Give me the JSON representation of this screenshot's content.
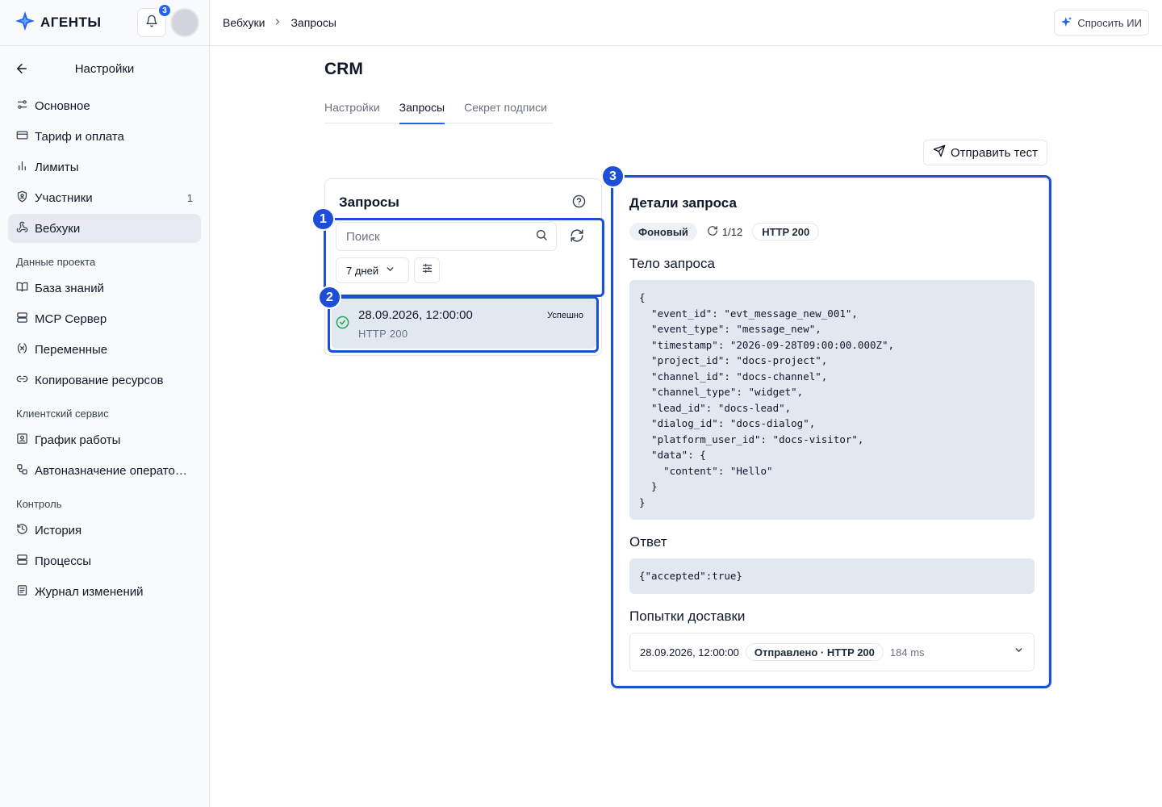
{
  "app": {
    "name": "АГЕНТЫ",
    "notifications_count": "3"
  },
  "sidebar": {
    "title": "Настройки",
    "items": [
      {
        "label": "Основное",
        "icon": "sliders-icon"
      },
      {
        "label": "Тариф и оплата",
        "icon": "credit-card-icon"
      },
      {
        "label": "Лимиты",
        "icon": "bar-chart-icon"
      },
      {
        "label": "Участники",
        "icon": "user-shield-icon",
        "count": "1"
      },
      {
        "label": "Вебхуки",
        "icon": "webhook-icon",
        "active": true
      }
    ],
    "section_project": "Данные проекта",
    "project_items": [
      {
        "label": "База знаний",
        "icon": "book-icon"
      },
      {
        "label": "MCP Сервер",
        "icon": "server-icon"
      },
      {
        "label": "Переменные",
        "icon": "variable-icon"
      },
      {
        "label": "Копирование ресурсов",
        "icon": "link-icon"
      }
    ],
    "section_client": "Клиентский сервис",
    "client_items": [
      {
        "label": "График работы",
        "icon": "calendar-icon"
      },
      {
        "label": "Автоназначение операторов",
        "icon": "workflow-icon"
      }
    ],
    "section_control": "Контроль",
    "control_items": [
      {
        "label": "История",
        "icon": "history-icon"
      },
      {
        "label": "Процессы",
        "icon": "server-icon"
      },
      {
        "label": "Журнал изменений",
        "icon": "log-icon"
      }
    ]
  },
  "topbar": {
    "breadcrumb": [
      "Вебхуки",
      "Запросы"
    ],
    "ask_ai": "Спросить ИИ"
  },
  "page": {
    "title": "CRM",
    "tabs": [
      "Настройки",
      "Запросы",
      "Секрет подписи"
    ],
    "active_tab": "Запросы",
    "send_test": "Отправить тест"
  },
  "requests": {
    "title": "Запросы",
    "search_placeholder": "Поиск",
    "period": "7 дней",
    "items": [
      {
        "datetime": "28.09.2026, 12:00:00",
        "code": "HTTP 200",
        "status": "Успешно"
      }
    ]
  },
  "details": {
    "title": "Детали запроса",
    "mode": "Фоновый",
    "attempts": "1/12",
    "http": "HTTP 200",
    "body_title": "Тело запроса",
    "body": "{\n  \"event_id\": \"evt_message_new_001\",\n  \"event_type\": \"message_new\",\n  \"timestamp\": \"2026-09-28T09:00:00.000Z\",\n  \"project_id\": \"docs-project\",\n  \"channel_id\": \"docs-channel\",\n  \"channel_type\": \"widget\",\n  \"lead_id\": \"docs-lead\",\n  \"dialog_id\": \"docs-dialog\",\n  \"platform_user_id\": \"docs-visitor\",\n  \"data\": {\n    \"content\": \"Hello\"\n  }\n}",
    "response_title": "Ответ",
    "response": "{\"accepted\":true}",
    "delivery_title": "Попытки доставки",
    "delivery": [
      {
        "datetime": "28.09.2026, 12:00:00",
        "status": "Отправлено · HTTP 200",
        "duration": "184 ms"
      }
    ]
  },
  "annotations": [
    "1",
    "2",
    "3"
  ],
  "colors": {
    "accent": "#2563eb",
    "highlight": "#1d4ed8",
    "success": "#16a34a"
  }
}
